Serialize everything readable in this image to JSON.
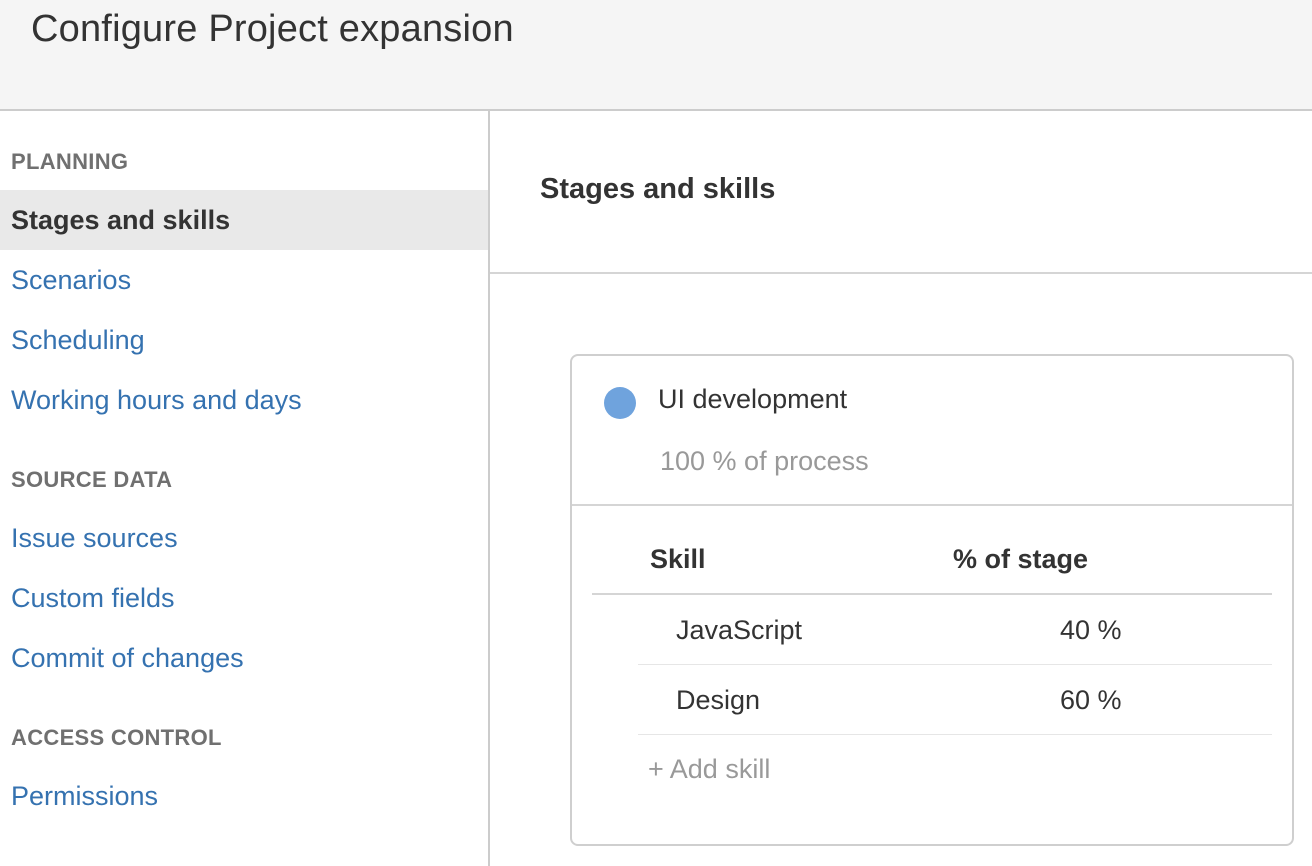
{
  "header": {
    "title": "Configure Project expansion"
  },
  "sidebar": {
    "sections": [
      {
        "heading": "PLANNING",
        "items": [
          {
            "label": "Stages and skills",
            "active": true
          },
          {
            "label": "Scenarios",
            "active": false
          },
          {
            "label": "Scheduling",
            "active": false
          },
          {
            "label": "Working hours and days",
            "active": false
          }
        ]
      },
      {
        "heading": "SOURCE DATA",
        "items": [
          {
            "label": "Issue sources",
            "active": false
          },
          {
            "label": "Custom fields",
            "active": false
          },
          {
            "label": "Commit of changes",
            "active": false
          }
        ]
      },
      {
        "heading": "ACCESS CONTROL",
        "items": [
          {
            "label": "Permissions",
            "active": false
          }
        ]
      }
    ]
  },
  "main": {
    "title": "Stages and skills",
    "stage": {
      "name": "UI development",
      "percent_label": "100 % of process",
      "color": "#6fa3dd",
      "table": {
        "col_skill": "Skill",
        "col_pct": "% of stage",
        "rows": [
          {
            "skill": "JavaScript",
            "pct": "40 %"
          },
          {
            "skill": "Design",
            "pct": "60 %"
          }
        ]
      },
      "add_skill_label": "+ Add skill"
    }
  },
  "colors": {
    "link": "#3572b0",
    "header_bg": "#f5f5f5",
    "active_bg": "#e9e9e9",
    "muted_text": "#999999"
  }
}
